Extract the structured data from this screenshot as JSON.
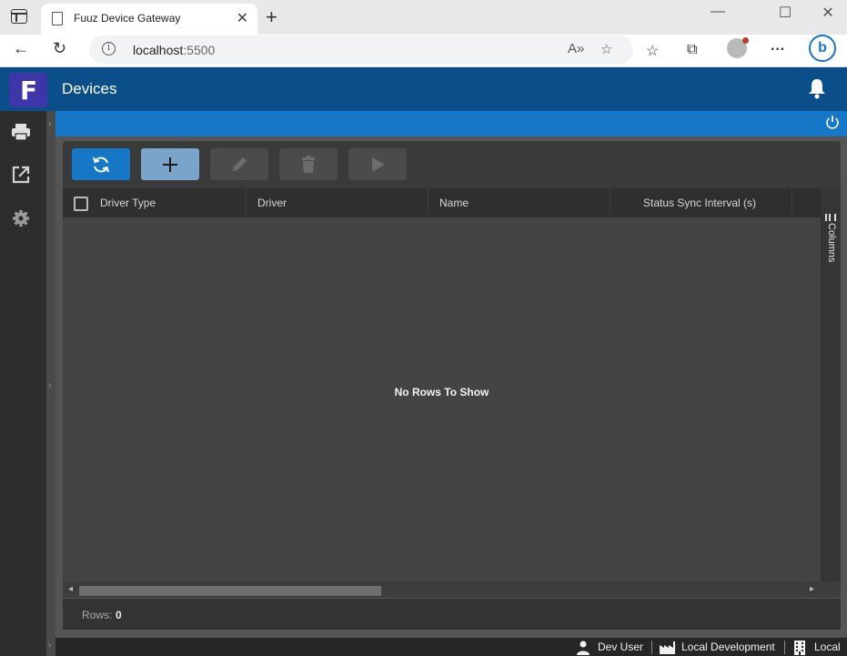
{
  "browser": {
    "tab_title": "Fuuz Device Gateway",
    "address_host": "localhost",
    "address_port": ":5500"
  },
  "app": {
    "title": "Devices",
    "accent_color": "#0b4f8a",
    "subbar_color": "#1677c6",
    "logo_color": "#3d35a8"
  },
  "sidebar": {
    "items": [
      {
        "name": "printer-icon"
      },
      {
        "name": "external-link-icon"
      },
      {
        "name": "gear-icon"
      }
    ]
  },
  "toolbar": {
    "buttons": [
      {
        "name": "refresh-button",
        "icon": "refresh-icon",
        "color": "#1677c6"
      },
      {
        "name": "add-button",
        "icon": "plus-icon",
        "color": "#7aa4c9"
      },
      {
        "name": "edit-button",
        "icon": "pencil-icon",
        "disabled": true
      },
      {
        "name": "delete-button",
        "icon": "trash-icon",
        "disabled": true
      },
      {
        "name": "run-button",
        "icon": "play-icon",
        "disabled": true
      }
    ]
  },
  "grid": {
    "columns": [
      "Driver Type",
      "Driver",
      "Name",
      "Status Sync Interval (s)"
    ],
    "empty_message": "No Rows To Show",
    "side_panel_label": "Columns",
    "rows_label": "Rows:",
    "rows_count": "0"
  },
  "footer": {
    "user": "Dev User",
    "environment": "Local Development",
    "site": "Local"
  }
}
